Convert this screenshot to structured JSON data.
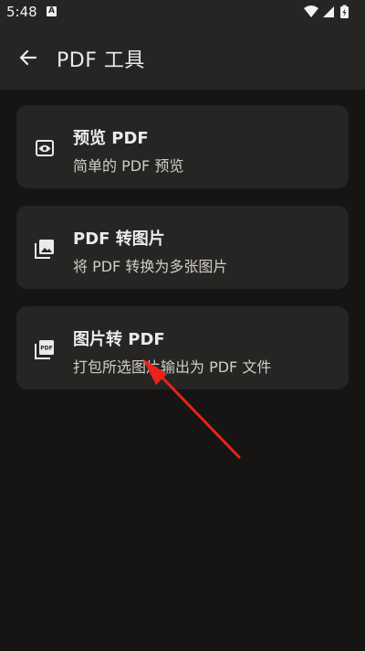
{
  "status_bar": {
    "time": "5:48",
    "badge_letter": "A",
    "icons": [
      "wifi-icon",
      "signal-icon",
      "battery-charging-icon"
    ]
  },
  "app_bar": {
    "title": "PDF 工具",
    "back_icon": "arrow-left-icon"
  },
  "tools": [
    {
      "title": "预览 PDF",
      "subtitle": "简单的 PDF 预览",
      "icon": "eye-icon"
    },
    {
      "title": "PDF 转图片",
      "subtitle": "将 PDF 转换为多张图片",
      "icon": "image-icon"
    },
    {
      "title": "图片转 PDF",
      "subtitle": "打包所选图片输出为 PDF 文件",
      "icon": "pdf-stack-icon",
      "icon_text": "PDF"
    }
  ],
  "annotation": {
    "type": "arrow",
    "color": "#e8231c",
    "target": "tools.2.subtitle"
  },
  "colors": {
    "background": "#161514",
    "surface": "#262523",
    "text_primary": "#ecebe9",
    "text_secondary": "#cfcdca"
  }
}
